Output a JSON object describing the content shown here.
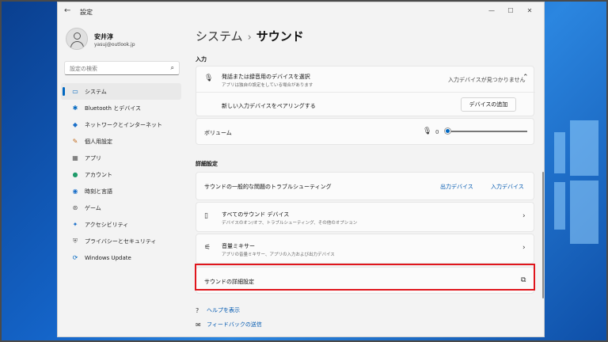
{
  "window": {
    "title": "設定"
  },
  "user": {
    "name": "安井淳",
    "email": "yasuj@outlook.jp"
  },
  "search": {
    "placeholder": "設定の検索"
  },
  "nav": [
    {
      "label": "システム",
      "icon": "monitor-icon",
      "selected": true
    },
    {
      "label": "Bluetooth とデバイス",
      "icon": "bluetooth-icon"
    },
    {
      "label": "ネットワークとインターネット",
      "icon": "wifi-icon"
    },
    {
      "label": "個人用設定",
      "icon": "brush-icon"
    },
    {
      "label": "アプリ",
      "icon": "apps-icon"
    },
    {
      "label": "アカウント",
      "icon": "person-icon"
    },
    {
      "label": "時刻と言語",
      "icon": "globe-icon"
    },
    {
      "label": "ゲーム",
      "icon": "gamepad-icon"
    },
    {
      "label": "アクセシビリティ",
      "icon": "accessibility-icon"
    },
    {
      "label": "プライバシーとセキュリティ",
      "icon": "shield-icon"
    },
    {
      "label": "Windows Update",
      "icon": "update-icon"
    }
  ],
  "breadcrumb": {
    "parent": "システム",
    "current": "サウンド"
  },
  "input": {
    "header": "入力",
    "device_title": "発話または録音用のデバイスを選択",
    "device_sub": "アプリは独自の設定をしている場合があります",
    "device_status": "入力デバイスが見つかりません",
    "pair_label": "新しい入力デバイスをペアリングする",
    "add_button": "デバイスの追加",
    "volume_label": "ボリューム",
    "volume_value": "0"
  },
  "advanced": {
    "header": "詳細設定",
    "troubleshoot_label": "サウンドの一般的な問題のトラブルシューティング",
    "output_link": "出力デバイス",
    "input_link": "入力デバイス",
    "all_devices_title": "すべてのサウンド デバイス",
    "all_devices_sub": "デバイスのオン/オフ、トラブルシューティング、その他のオプション",
    "mixer_title": "音量ミキサー",
    "mixer_sub": "アプリの音量ミキサー、アプリの入力および出力デバイス",
    "more_settings": "サウンドの詳細設定"
  },
  "footer": {
    "help": "ヘルプを表示",
    "feedback": "フィードバックの送信"
  },
  "colors": {
    "accent": "#0067c0",
    "highlight": "#e0161d"
  }
}
